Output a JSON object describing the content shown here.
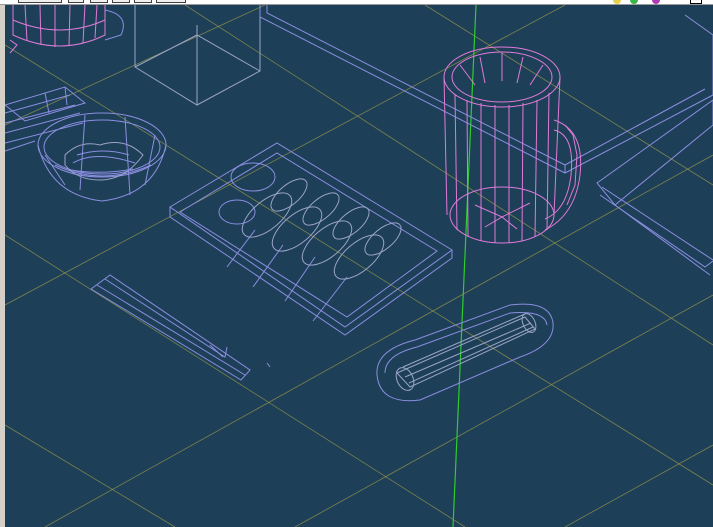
{
  "toolbar": {
    "icons": [
      "tool-icon-yellow",
      "tool-icon-green",
      "tool-icon-purple",
      "window-icon"
    ]
  },
  "viewport": {
    "mode": "wireframe",
    "background": "#1e3f58",
    "grid_color": "#9a9a4a",
    "axis_color": "#2ecc2e",
    "object_color": "#8a8ee0",
    "selected_color": "#e07ad8"
  },
  "scene": {
    "objects": [
      {
        "name": "mug-partial"
      },
      {
        "name": "box-partial"
      },
      {
        "name": "tray-right"
      },
      {
        "name": "tray-far-right"
      },
      {
        "name": "bowl"
      },
      {
        "name": "skewer-plate"
      },
      {
        "name": "beer-mug"
      },
      {
        "name": "chopsticks"
      },
      {
        "name": "oshibori-dish"
      }
    ]
  }
}
